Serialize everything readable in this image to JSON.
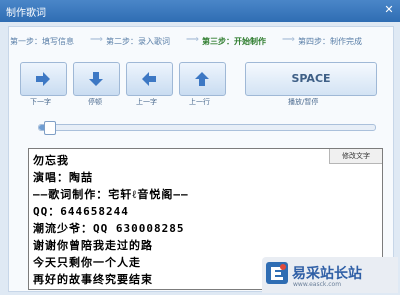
{
  "window": {
    "title": "制作歌词",
    "close_icon": "close-icon"
  },
  "steps": [
    {
      "label": "第一步：填写信息",
      "active": false
    },
    {
      "label": "第二步：录入歌词",
      "active": false
    },
    {
      "label": "第三步：开始制作",
      "active": true
    },
    {
      "label": "第四步：制作完成",
      "active": false
    }
  ],
  "controls": [
    {
      "icon": "arrow-right-icon",
      "label": "下一字"
    },
    {
      "icon": "arrow-down-icon",
      "label": "停顿"
    },
    {
      "icon": "arrow-left-icon",
      "label": "上一字"
    },
    {
      "icon": "arrow-up-icon",
      "label": "上一行"
    }
  ],
  "space_button": {
    "label": "SPACE",
    "caption": "播放/暂停"
  },
  "progress": {
    "value": 0.03
  },
  "editor": {
    "modify_label": "修改文字",
    "lines": [
      "勿忘我",
      "演唱：陶喆",
      "——歌词制作：宅轩ℓ音悦阁——",
      "QQ：644658244",
      "潮流少爷：QQ 630008285",
      "谢谢你曾陪我走过的路",
      "今天只剩你一个人走",
      "再好的故事终究要结束"
    ]
  },
  "watermark": {
    "name": "易采站长站",
    "url": "www.easck.com"
  }
}
